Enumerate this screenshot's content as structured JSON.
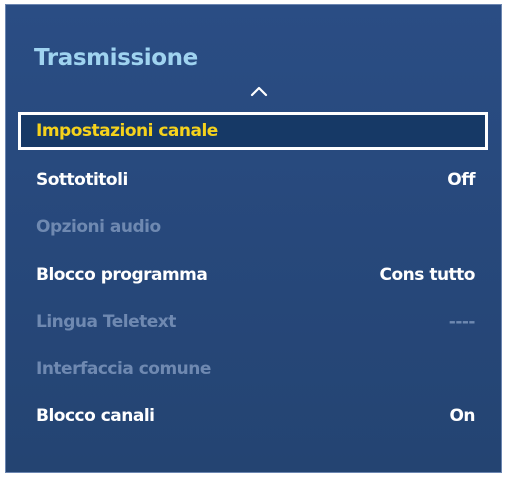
{
  "menu": {
    "title": "Trasmissione",
    "items": [
      {
        "label": "Impostazioni canale",
        "value": ""
      },
      {
        "label": "Sottotitoli",
        "value": "Off"
      },
      {
        "label": "Opzioni audio",
        "value": ""
      },
      {
        "label": "Blocco programma",
        "value": "Cons tutto"
      },
      {
        "label": "Lingua Teletext",
        "value": "----"
      },
      {
        "label": "Interfaccia comune",
        "value": ""
      },
      {
        "label": "Blocco canali",
        "value": "On"
      }
    ]
  },
  "colors": {
    "panel_background": "#27487b",
    "title": "#9fd3f0",
    "selected_text": "#f5d21c",
    "enabled_text": "#ffffff",
    "disabled_text": "#6f89b1"
  },
  "icons": {
    "scroll_up": "chevron-up-icon"
  }
}
